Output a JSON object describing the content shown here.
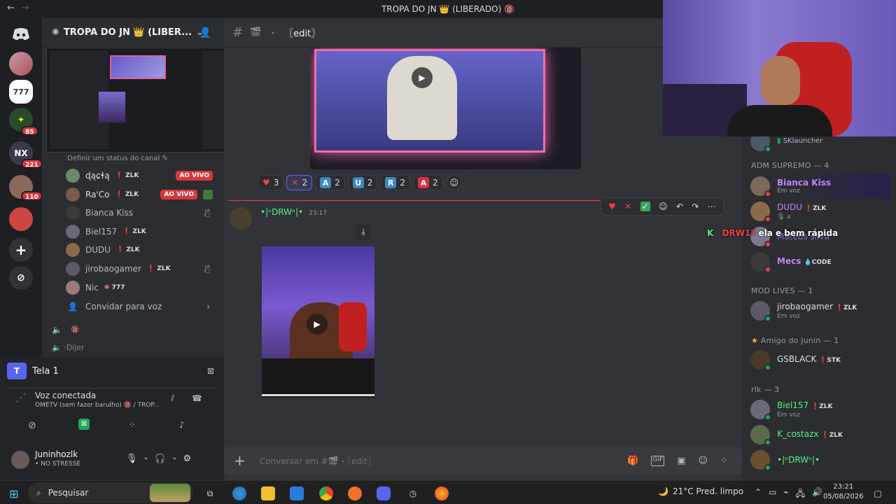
{
  "window": {
    "title": "TROPA DO JN 👑 (LIBERADO) 🔞"
  },
  "servers": {
    "badges": [
      "85",
      "221",
      "110"
    ]
  },
  "sidebar": {
    "server_name": "TROPA DO JN 👑 (LIBER...",
    "status_prompt": "Definir um status do canal",
    "voice_users": [
      {
        "name": "ɖąɕɬą",
        "tag": "ZLK",
        "live": "AO VIVO"
      },
      {
        "name": "Ra'Co",
        "tag": "ZLK",
        "live": "AO VIVO"
      },
      {
        "name": "Bianca Kiss"
      },
      {
        "name": "Biel157",
        "tag": "ZLK"
      },
      {
        "name": "DUDU",
        "tag": "ZLK"
      },
      {
        "name": "jirobaogamer",
        "tag": "ZLK"
      },
      {
        "name": "Nic",
        "tag": "777"
      }
    ],
    "invite_label": "Convidar para voz",
    "next_channel_badge": "🔞",
    "cut_channel": "⋅Dijer"
  },
  "voice_panel": {
    "screen_label": "Tela 1",
    "connected_label": "Voz conectada",
    "channel_info": "OMETV (sem fazer barulho) 🔞 / TROP...",
    "user_name": "Juninhozlk",
    "user_status": "• NO STRESSE"
  },
  "chat": {
    "channel_name": "〖edit〗",
    "reactions": [
      {
        "emoji": "heart",
        "count": "3"
      },
      {
        "emoji": "X",
        "count": "2"
      },
      {
        "emoji": "A",
        "count": "2"
      },
      {
        "emoji": "U",
        "count": "2"
      },
      {
        "emoji": "R",
        "count": "2"
      },
      {
        "emoji": "A",
        "count": "2"
      }
    ],
    "message": {
      "author": "•|ᵒDRWᵒ|•",
      "time": "23:17"
    },
    "input_placeholder": "Conversar em #🎬・〖edit〗"
  },
  "overlay_chat": {
    "badge": "K",
    "user": "DRW1?",
    "text": "ela e bem rápida"
  },
  "members": {
    "top_item": {
      "name": "SKlauncher"
    },
    "groups": [
      {
        "header": "ADM SUPREMO — 4",
        "items": [
          {
            "name": "Bianca Kiss",
            "sub": "Em voz"
          },
          {
            "name": "DUDU",
            "tag": "ZLK",
            "sub": "a"
          },
          {
            "name": "Mateus silva"
          },
          {
            "name": "Mecs",
            "tag": "CODE"
          }
        ]
      },
      {
        "header": "MOD LIVES — 1",
        "items": [
          {
            "name": "jirobaogamer",
            "tag": "ZLK",
            "sub": "Em voz"
          }
        ]
      },
      {
        "header": "Amigo do Junin — 1",
        "items": [
          {
            "name": "GSBLACK",
            "tag": "STK"
          }
        ]
      },
      {
        "header": "rlk — 3",
        "items": [
          {
            "name": "Biel157",
            "tag": "ZLK",
            "sub": "Em voz"
          },
          {
            "name": "K_costazx",
            "tag": "ZLK"
          },
          {
            "name": "•|ᵒDRWᵒ|•"
          }
        ]
      }
    ]
  },
  "taskbar": {
    "search": "Pesquisar",
    "weather": "21°C  Pred. limpo",
    "time": "23:21",
    "date": "05/08/2026"
  },
  "colors": {
    "accent": "#5865f2",
    "live": "#da373c",
    "online": "#23a55a",
    "mod_green": "#57f287",
    "purple_name": "#c084fc"
  }
}
